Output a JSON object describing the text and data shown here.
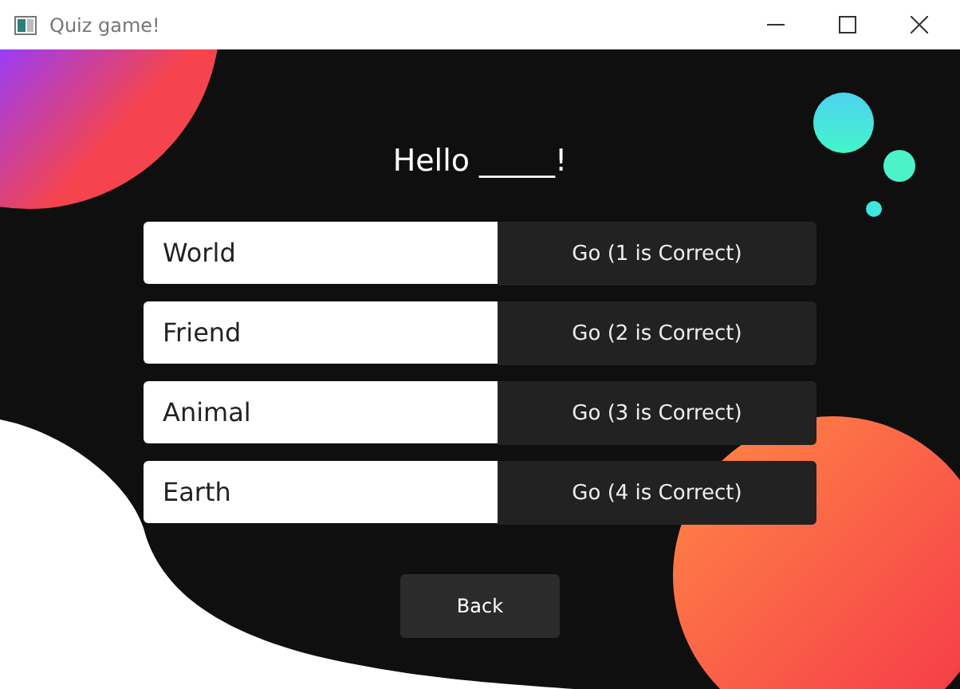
{
  "window": {
    "title": "Quiz game!"
  },
  "question": "Hello _____!",
  "answers": [
    {
      "value": "World",
      "button": "Go (1 is Correct)"
    },
    {
      "value": "Friend",
      "button": "Go (2 is Correct)"
    },
    {
      "value": "Animal",
      "button": "Go (3 is Correct)"
    },
    {
      "value": "Earth",
      "button": "Go (4 is Correct)"
    }
  ],
  "back_button": "Back"
}
